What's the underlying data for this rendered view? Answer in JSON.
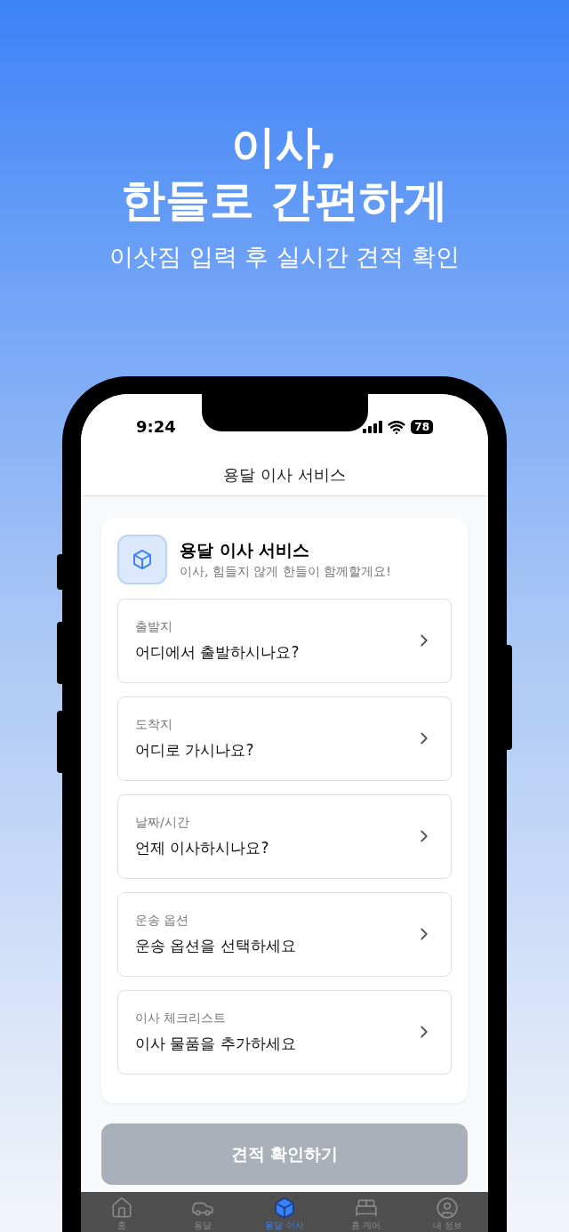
{
  "hero": {
    "title_lines": [
      "이사,",
      "한들로 간편하게"
    ],
    "subtitle": "이삿짐 입력 후 실시간 견적 확인"
  },
  "status_bar": {
    "time": "9:24",
    "battery": "78"
  },
  "header": {
    "title": "용달 이사 서비스"
  },
  "service_card": {
    "title": "용달 이사 서비스",
    "subtitle": "이사, 힘들지 않게 한들이 함께할게요!",
    "fields": [
      {
        "label": "출발지",
        "value": "어디에서 출발하시나요?"
      },
      {
        "label": "도착지",
        "value": "어디로 가시나요?"
      },
      {
        "label": "날짜/시간",
        "value": "언제 이사하시나요?"
      },
      {
        "label": "운송 옵션",
        "value": "운송 옵션을 선택하세요"
      },
      {
        "label": "이사 체크리스트",
        "value": "이사 물품을 추가하세요"
      }
    ]
  },
  "quote_button": {
    "label": "견적 확인하기",
    "disabled": true
  },
  "tab_bar": [
    {
      "kind": "home",
      "label": "홈",
      "selected": false
    },
    {
      "kind": "truck",
      "label": "용달",
      "selected": false
    },
    {
      "kind": "moving",
      "label": "용달 이사",
      "selected": true
    },
    {
      "kind": "care",
      "label": "홈 케어",
      "selected": false
    },
    {
      "kind": "profile",
      "label": "내 정보",
      "selected": false
    }
  ]
}
